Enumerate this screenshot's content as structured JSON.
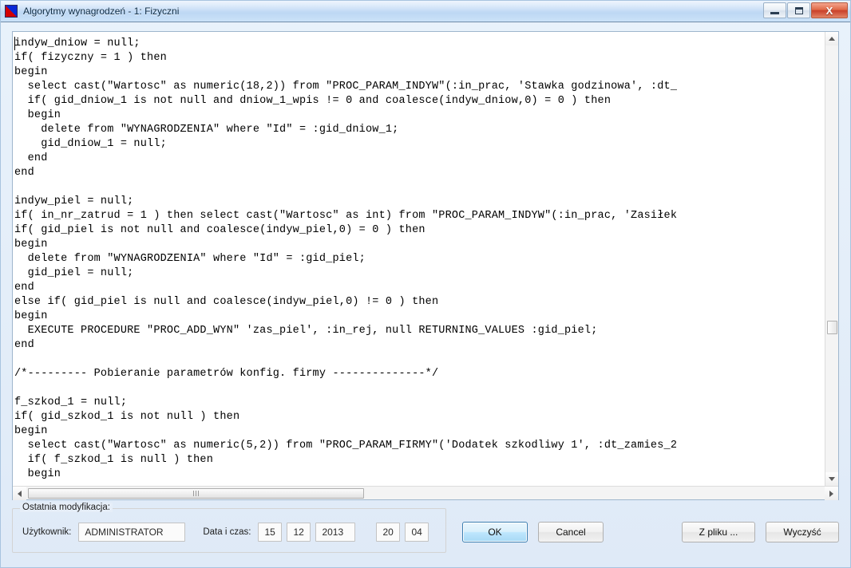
{
  "window": {
    "title": "Algorytmy wynagrodzeń - 1: Fizyczni",
    "icon": "app-icon",
    "minimize_label": "Minimalizuj",
    "maximize_label": "Maksymalizuj",
    "close_label": "X"
  },
  "editor": {
    "code": "indyw_dniow = null;\nif( fizyczny = 1 ) then\nbegin\n  select cast(\"Wartosc\" as numeric(18,2)) from \"PROC_PARAM_INDYW\"(:in_prac, 'Stawka godzinowa', :dt_\n  if( gid_dniow_1 is not null and dniow_1_wpis != 0 and coalesce(indyw_dniow,0) = 0 ) then\n  begin\n    delete from \"WYNAGRODZENIA\" where \"Id\" = :gid_dniow_1;\n    gid_dniow_1 = null;\n  end\nend\n\nindyw_piel = null;\nif( in_nr_zatrud = 1 ) then select cast(\"Wartosc\" as int) from \"PROC_PARAM_INDYW\"(:in_prac, 'Zasiłek\nif( gid_piel is not null and coalesce(indyw_piel,0) = 0 ) then\nbegin\n  delete from \"WYNAGRODZENIA\" where \"Id\" = :gid_piel;\n  gid_piel = null;\nend\nelse if( gid_piel is null and coalesce(indyw_piel,0) != 0 ) then\nbegin\n  EXECUTE PROCEDURE \"PROC_ADD_WYN\" 'zas_piel', :in_rej, null RETURNING_VALUES :gid_piel;\nend\n\n/*--------- Pobieranie parametrów konfig. firmy --------------*/\n\nf_szkod_1 = null;\nif( gid_szkod_1 is not null ) then\nbegin\n  select cast(\"Wartosc\" as numeric(5,2)) from \"PROC_PARAM_FIRMY\"('Dodatek szkodliwy 1', :dt_zamies_2\n  if( f_szkod_1 is null ) then\n  begin"
  },
  "modification_group": {
    "legend": "Ostatnia modyfikacja:",
    "user_label": "Użytkownik:",
    "user_value": "ADMINISTRATOR",
    "datetime_label": "Data i czas:",
    "day": "15",
    "month": "12",
    "year": "2013",
    "hour": "20",
    "minute": "04"
  },
  "buttons": {
    "ok": "OK",
    "cancel": "Cancel",
    "from_file": "Z pliku ...",
    "clear": "Wyczyść"
  }
}
